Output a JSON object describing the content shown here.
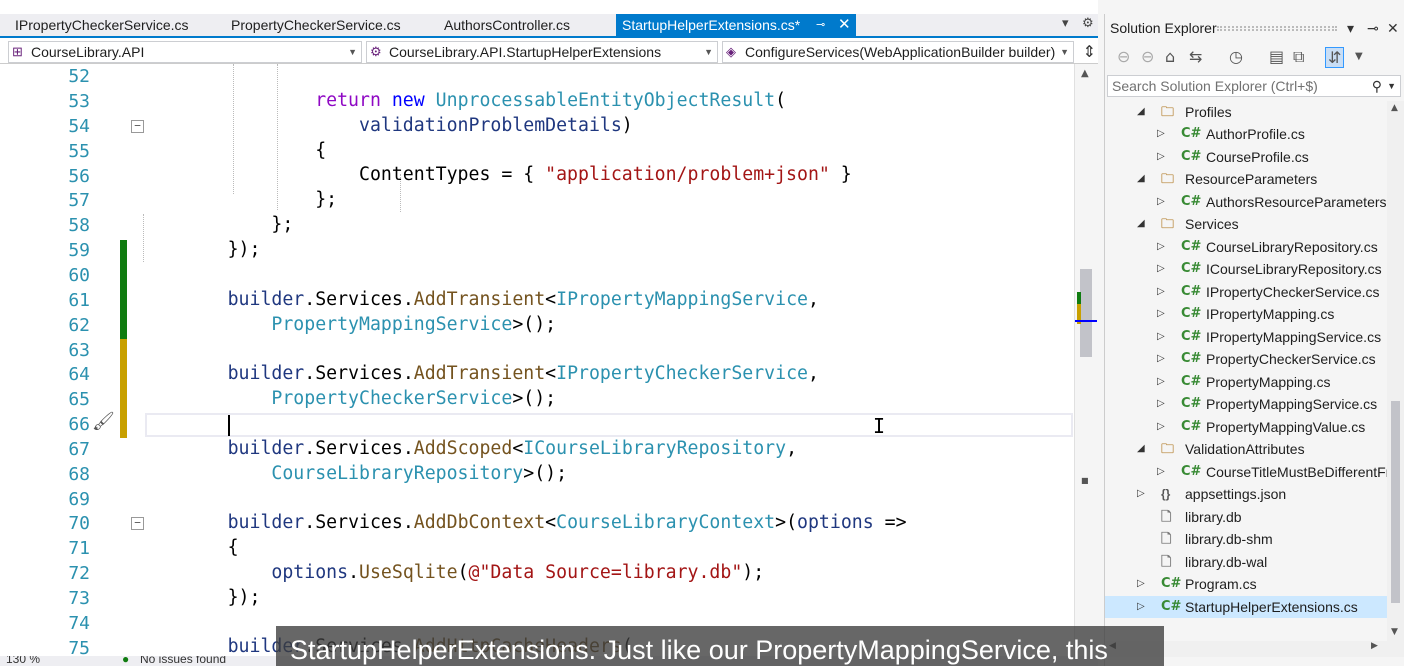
{
  "tabs": [
    {
      "label": "IPropertyCheckerService.cs",
      "active": false
    },
    {
      "label": "PropertyCheckerService.cs",
      "active": false
    },
    {
      "label": "AuthorsController.cs",
      "active": false
    },
    {
      "label": "StartupHelperExtensions.cs*",
      "active": true
    }
  ],
  "navbar": {
    "project": "CourseLibrary.API",
    "type": "CourseLibrary.API.StartupHelperExtensions",
    "member": "ConfigureServices(WebApplicationBuilder builder)"
  },
  "editor": {
    "line_numbers": [
      "52",
      "53",
      "54",
      "55",
      "56",
      "57",
      "58",
      "59",
      "60",
      "61",
      "62",
      "63",
      "64",
      "65",
      "66",
      "67",
      "68",
      "69",
      "70",
      "71",
      "72",
      "73",
      "74",
      "75"
    ],
    "current_line": "66"
  },
  "solution_explorer": {
    "title": "Solution Explorer",
    "search_placeholder": "Search Solution Explorer (Ctrl+$)",
    "items": [
      {
        "label": "Profiles",
        "icon": "folder-icon"
      },
      {
        "label": "AuthorProfile.cs",
        "icon": "csharp-icon"
      },
      {
        "label": "CourseProfile.cs",
        "icon": "csharp-icon"
      },
      {
        "label": "ResourceParameters",
        "icon": "folder-icon"
      },
      {
        "label": "AuthorsResourceParameters.cs",
        "icon": "csharp-icon"
      },
      {
        "label": "Services",
        "icon": "folder-icon"
      },
      {
        "label": "CourseLibraryRepository.cs",
        "icon": "csharp-icon"
      },
      {
        "label": "ICourseLibraryRepository.cs",
        "icon": "csharp-icon"
      },
      {
        "label": "IPropertyCheckerService.cs",
        "icon": "csharp-icon"
      },
      {
        "label": "IPropertyMapping.cs",
        "icon": "csharp-icon"
      },
      {
        "label": "IPropertyMappingService.cs",
        "icon": "csharp-icon"
      },
      {
        "label": "PropertyCheckerService.cs",
        "icon": "csharp-icon"
      },
      {
        "label": "PropertyMapping.cs",
        "icon": "csharp-icon"
      },
      {
        "label": "PropertyMappingService.cs",
        "icon": "csharp-icon"
      },
      {
        "label": "PropertyMappingValue.cs",
        "icon": "csharp-icon"
      },
      {
        "label": "ValidationAttributes",
        "icon": "folder-icon"
      },
      {
        "label": "CourseTitleMustBeDifferentFrc",
        "icon": "csharp-icon"
      },
      {
        "label": "appsettings.json",
        "icon": "json-icon"
      },
      {
        "label": "library.db",
        "icon": "file-icon"
      },
      {
        "label": "library.db-shm",
        "icon": "file-icon"
      },
      {
        "label": "library.db-wal",
        "icon": "file-icon"
      },
      {
        "label": "Program.cs",
        "icon": "csharp-icon"
      },
      {
        "label": "StartupHelperExtensions.cs",
        "icon": "csharp-icon",
        "selected": true
      }
    ],
    "csharp_glyph": "C#"
  },
  "status": {
    "zoom": "130 %",
    "issues": "No issues found"
  },
  "caption": "StartupHelperExtensions. Just like our PropertyMappingService, this",
  "colors": {
    "accent": "#007acc",
    "change_saved": "#107c10",
    "change_unsaved": "#c8a000"
  }
}
